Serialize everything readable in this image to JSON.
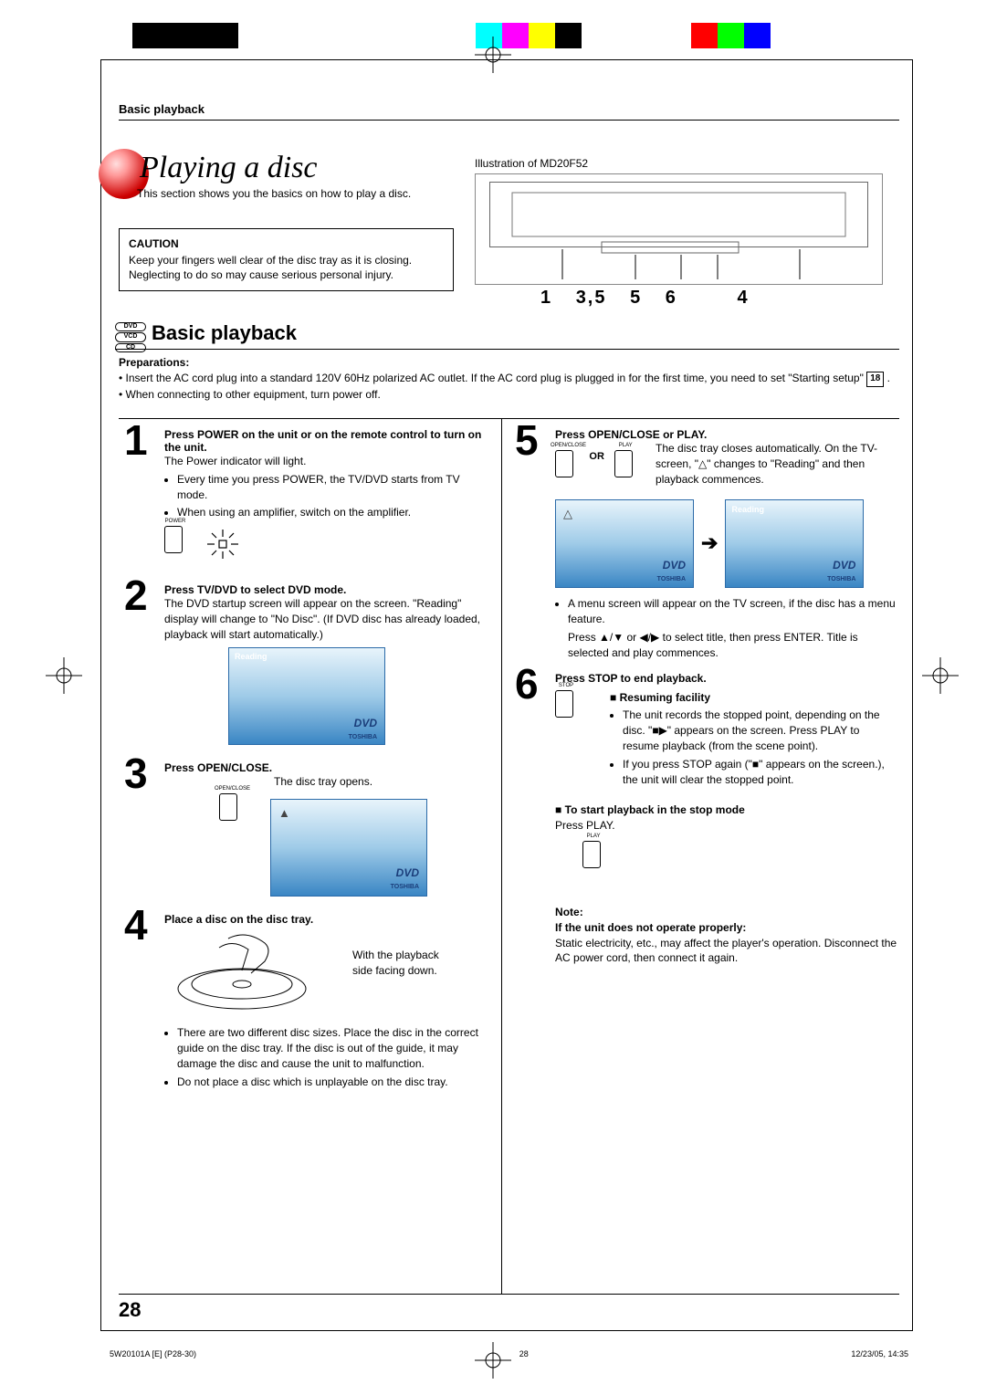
{
  "header_section": "Basic playback",
  "title": "Playing a disc",
  "subtitle": "This section shows you the basics on how to play a disc.",
  "caution": {
    "head": "CAUTION",
    "body": "Keep your fingers well clear of the disc tray as it is closing. Neglecting to do so may cause serious personal injury."
  },
  "illustration_label": "Illustration of MD20F52",
  "callouts": [
    "1",
    "3,5",
    "5",
    "6",
    "4"
  ],
  "badges": [
    "DVD",
    "VCD",
    "CD"
  ],
  "section_heading": "Basic playback",
  "prep_head": "Preparations:",
  "prep1": "Insert the AC cord plug into a standard 120V 60Hz polarized AC outlet. If the AC cord plug is plugged in for the first time, you need to set \"Starting setup\" ",
  "prep_ref": "18",
  "prep2": "When connecting to other equipment, turn power off.",
  "steps": {
    "s1": {
      "n": "1",
      "t": "Press POWER on the unit or on the remote control to turn on the unit.",
      "b1": "The Power indicator will light.",
      "b2": "Every time you press POWER, the TV/DVD starts from TV mode.",
      "b3": "When using an amplifier, switch on the amplifier.",
      "btn": "POWER"
    },
    "s2": {
      "n": "2",
      "t": "Press TV/DVD to select DVD mode.",
      "b": "The DVD startup screen will appear on the screen. \"Reading\" display will change to \"No Disc\". (If DVD disc has already loaded, playback will start automatically.)",
      "osd": "Reading"
    },
    "s3": {
      "n": "3",
      "t": "Press OPEN/CLOSE.",
      "b": "The disc tray opens.",
      "btn": "OPEN/CLOSE"
    },
    "s4": {
      "n": "4",
      "t": "Place a disc on the disc tray.",
      "side": "With the playback side facing down.",
      "b1": "There are two different disc sizes. Place the disc in the correct guide on the disc tray. If the disc is out of the guide, it may damage the disc and cause the unit to malfunction.",
      "b2": "Do not place a disc which is unplayable on the disc tray."
    },
    "s5": {
      "n": "5",
      "t": "Press OPEN/CLOSE or PLAY.",
      "b": "The disc tray closes automatically. On the TV-screen, \"△\" changes to \"Reading\" and then playback commences.",
      "btn1": "OPEN/CLOSE",
      "btn2": "PLAY",
      "or": "OR",
      "osd_left": "△",
      "osd_right": "Reading",
      "b2": "A menu screen will appear on the TV screen, if the disc has a menu feature.",
      "b3": "Press ▲/▼ or ◀/▶ to select title, then press ENTER. Title is selected and play commences."
    },
    "s6": {
      "n": "6",
      "t": "Press STOP to end playback.",
      "btn": "STOP",
      "resume_head": "■  Resuming facility",
      "r1": "The unit records the stopped point, depending on the disc. \"■▶\" appears on the screen. Press PLAY to resume playback (from the scene point).",
      "r2": "If you press STOP again (\"■\" appears on the screen.), the unit will clear the stopped point.",
      "start_head": "■ To start playback in the stop mode",
      "start_body": "Press PLAY.",
      "btn2": "PLAY"
    }
  },
  "note": {
    "head": "Note:",
    "sub": "If the unit does not operate properly:",
    "body": "Static electricity, etc., may affect the player's operation. Disconnect the AC power cord, then connect it again."
  },
  "page_number": "28",
  "footer_left": "5W20101A [E] (P28-30)",
  "footer_mid": "28",
  "footer_right": "12/23/05, 14:35",
  "dvd_logo": "DVD",
  "brand": "TOSHIBA"
}
